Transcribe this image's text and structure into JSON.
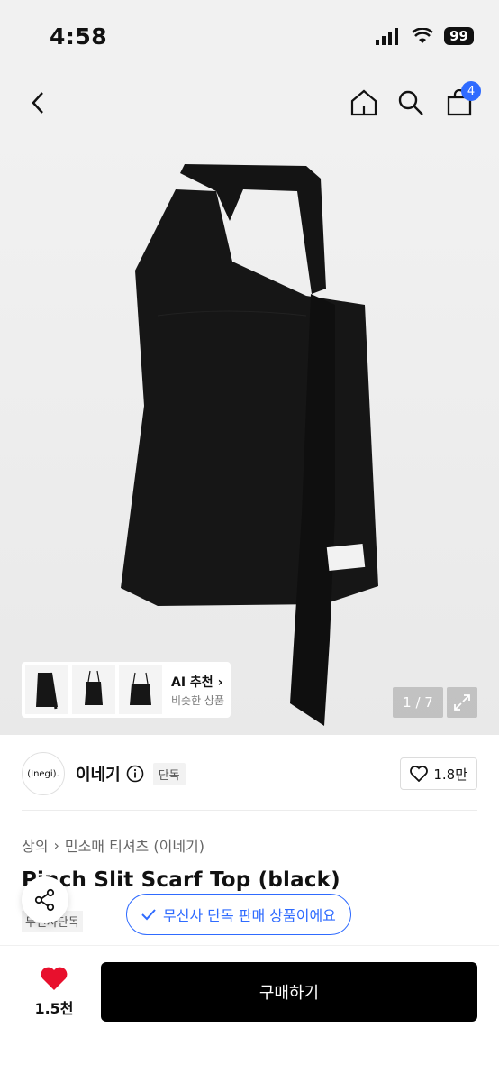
{
  "status_bar": {
    "time": "4:58",
    "battery": "99"
  },
  "nav": {
    "cart_count": "4"
  },
  "gallery": {
    "ai_title": "AI 추천",
    "ai_subtitle": "비슷한 상품",
    "page_indicator": "1 / 7"
  },
  "brand": {
    "logo_text": "(Inegi).",
    "name": "이네기",
    "exclusive_tag": "단독",
    "like_count": "1.8만"
  },
  "breadcrumb": {
    "category": "상의",
    "subcategory": "민소매 티셔츠 (이네기)"
  },
  "product": {
    "title": "Pinch Slit Scarf Top (black)",
    "musinsa_tag": "무신사단독"
  },
  "toast": {
    "text": "무신사 단독 판매 상품이에요"
  },
  "bottom": {
    "wish_count": "1.5천",
    "buy_label": "구매하기"
  },
  "colors": {
    "accent": "#2f6bff",
    "heart": "#e8102d",
    "buy_bg": "#000000"
  }
}
